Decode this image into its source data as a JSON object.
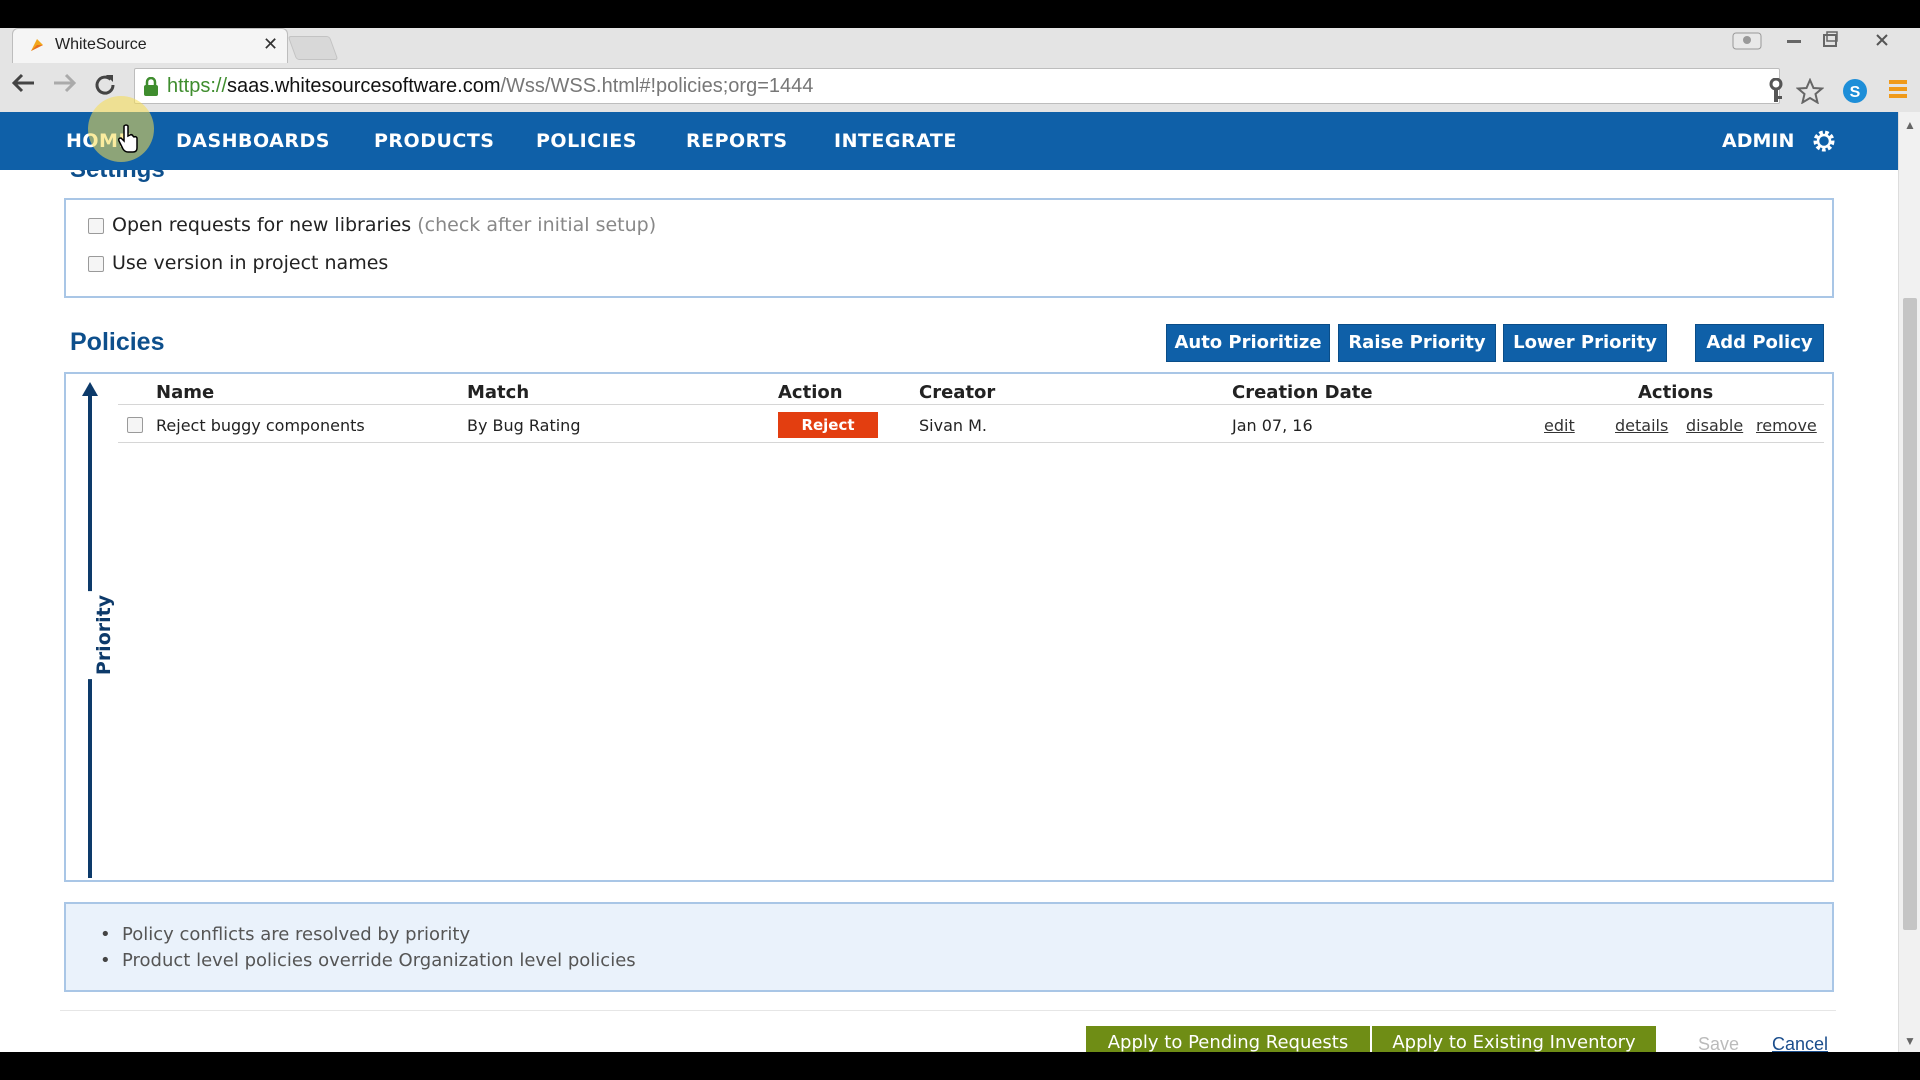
{
  "browser": {
    "tab_title": "WhiteSource",
    "tab_close": "✕",
    "url_scheme": "https://",
    "url_host": "saas.whitesourcesoftware.com",
    "url_path": "/Wss/WSS.html#!policies;org=1444"
  },
  "nav": {
    "items": [
      "HOME",
      "DASHBOARDS",
      "PRODUCTS",
      "POLICIES",
      "REPORTS",
      "INTEGRATE"
    ],
    "admin": "ADMIN"
  },
  "settings": {
    "heading": "Settings",
    "options": [
      {
        "label": "Open requests for new libraries",
        "hint": "(check after initial setup)",
        "checked": false
      },
      {
        "label": "Use version in project names",
        "hint": "",
        "checked": false
      }
    ]
  },
  "policies": {
    "heading": "Policies",
    "buttons": [
      "Auto Prioritize",
      "Raise Priority",
      "Lower Priority",
      "Add Policy"
    ],
    "columns": [
      "Name",
      "Match",
      "Action",
      "Creator",
      "Creation Date",
      "Actions"
    ],
    "priority_label": "Priority",
    "rows": [
      {
        "name": "Reject buggy components",
        "match": "By Bug Rating",
        "action": "Reject",
        "creator": "Sivan M.",
        "creation_date": "Jan 07, 16",
        "links": [
          "edit",
          "details",
          "disable",
          "remove"
        ]
      }
    ]
  },
  "info": {
    "items": [
      "Policy conflicts are resolved by priority",
      "Product level policies override Organization level policies"
    ]
  },
  "footer": {
    "apply_pending": "Apply to Pending Requests",
    "apply_existing": "Apply to Existing Inventory",
    "save": "Save",
    "cancel": "Cancel"
  },
  "colors": {
    "nav_blue": "#0f60a8",
    "reject_red": "#e33e10",
    "apply_green": "#6f8d15"
  }
}
